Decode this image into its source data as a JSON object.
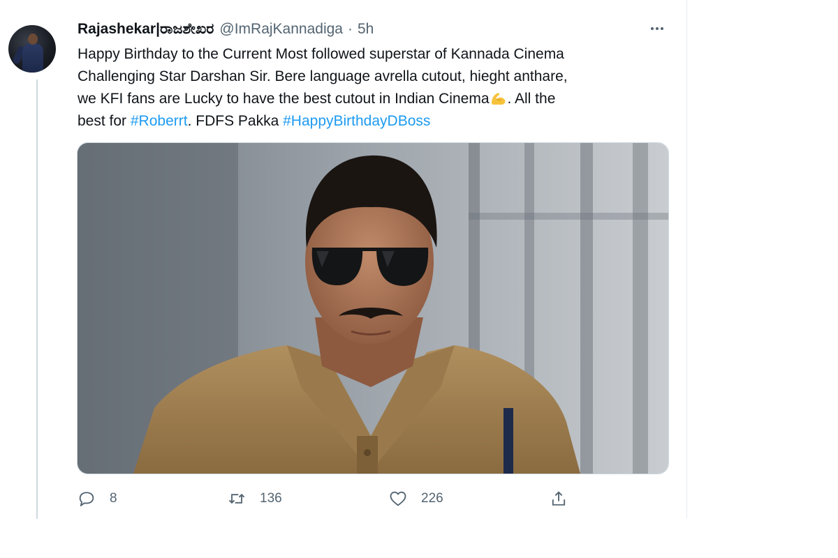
{
  "tweet": {
    "author_name": "Rajashekar|ರಾಜಶೇಖರ",
    "author_handle": "@ImRajKannadiga",
    "separator": "·",
    "time": "5h",
    "text": {
      "line1": "Happy Birthday to the Current Most followed superstar of Kannada Cinema",
      "line2": "Challenging Star Darshan Sir. Bere language avrella cutout, hieght anthare,",
      "line3_before_emoji": "we KFI fans are Lucky to have the best cutout in Indian Cinema",
      "emoji": "flexed-biceps-emoji",
      "line3_after_emoji": ". All the",
      "line4_before": "best for ",
      "hashtag1": "#Roberrt",
      "line4_middle": ". FDFS Pakka ",
      "hashtag2": "#HappyBirthdayDBoss"
    },
    "media": {
      "description_icon": "photo-of-man-in-police-uniform-with-aviator-sunglasses"
    },
    "actions": {
      "reply_count": "8",
      "retweet_count": "136",
      "like_count": "226"
    },
    "icons": {
      "more": "more-horizontal-icon",
      "reply": "reply-icon",
      "retweet": "retweet-icon",
      "like": "heart-icon",
      "share": "share-icon"
    },
    "colors": {
      "text": "#0f1419",
      "secondary": "#536471",
      "link": "#1d9bf0",
      "border": "#cfd9de"
    }
  }
}
